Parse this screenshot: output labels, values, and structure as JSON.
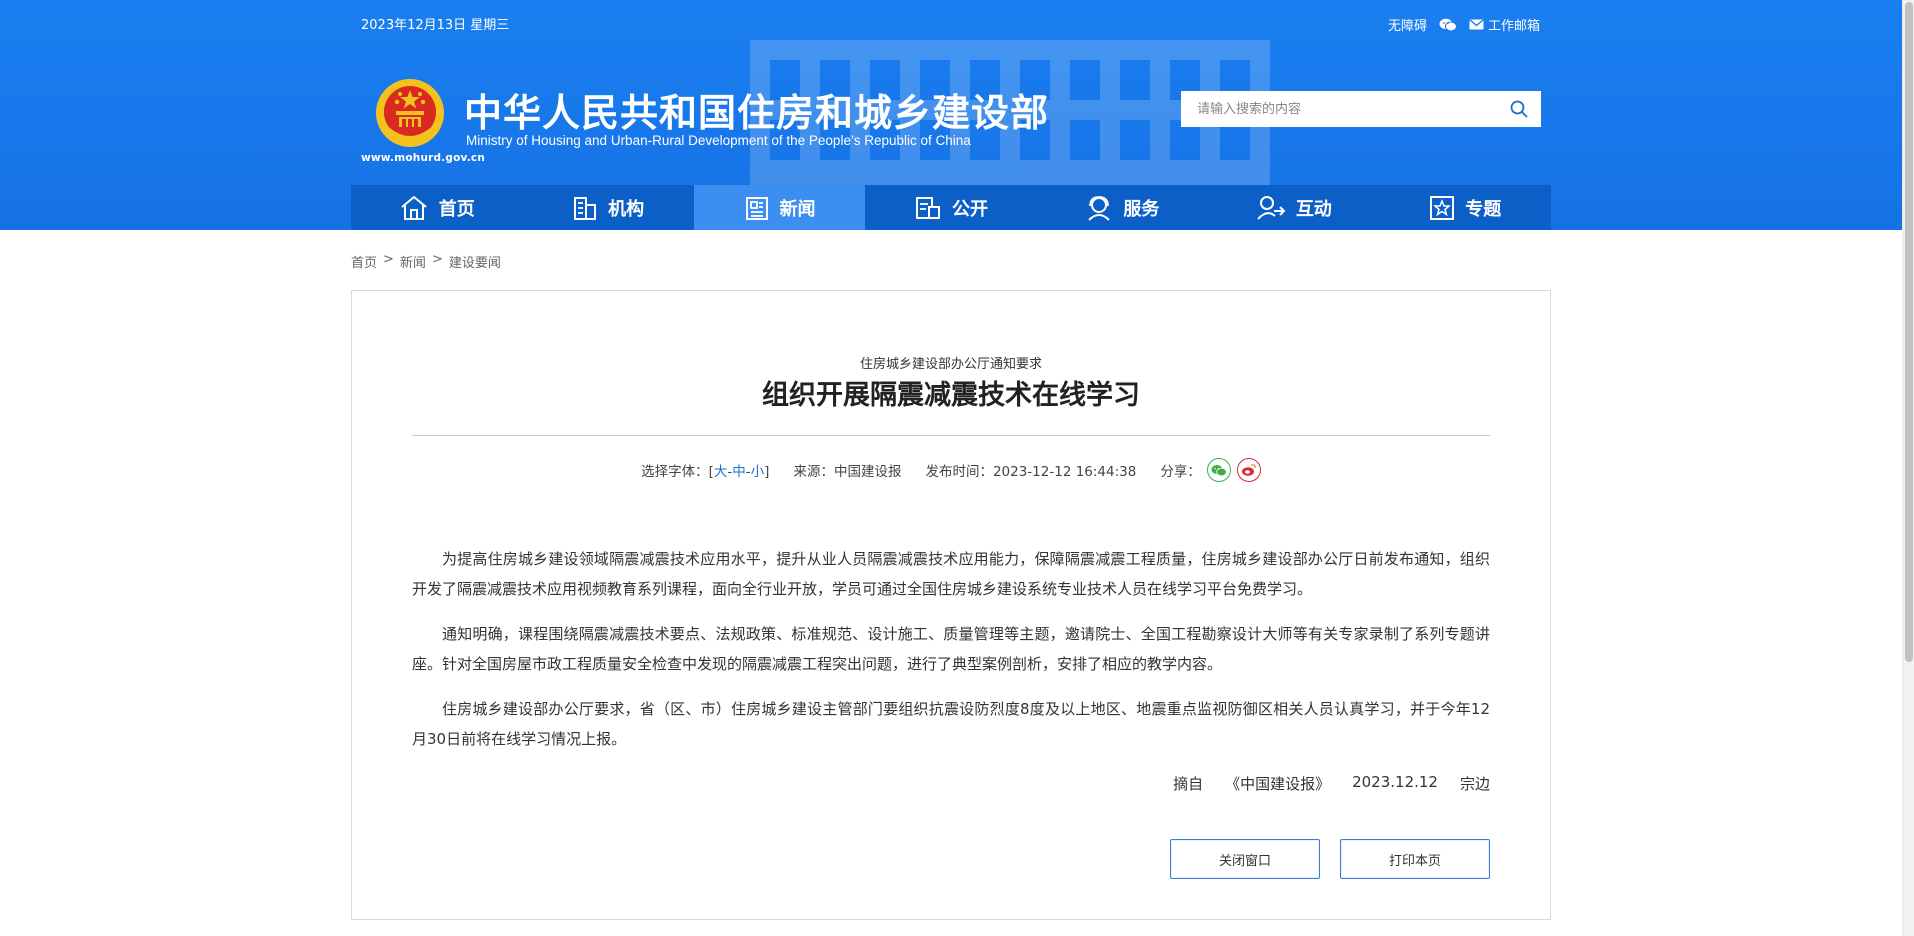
{
  "topbar": {
    "date": "2023年12月13日 星期三",
    "accessibility": "无障碍",
    "mail": "工作邮箱"
  },
  "branding": {
    "title": "中华人民共和国住房和城乡建设部",
    "subtitle": "Ministry of Housing and Urban-Rural Development of the People’s Republic of China",
    "url": "www.mohurd.gov.cn"
  },
  "search": {
    "placeholder": "请输入搜索的内容"
  },
  "nav": {
    "items": [
      {
        "label": "首页"
      },
      {
        "label": "机构"
      },
      {
        "label": "新闻"
      },
      {
        "label": "公开"
      },
      {
        "label": "服务"
      },
      {
        "label": "互动"
      },
      {
        "label": "专题"
      }
    ],
    "active_index": 2
  },
  "breadcrumb": {
    "home": "首页",
    "news": "新闻",
    "current": "建设要闻",
    "sep": ">"
  },
  "article": {
    "pretitle": "住房城乡建设部办公厅通知要求",
    "title": "组织开展隔震减震技术在线学习",
    "meta": {
      "font_label": "选择字体：[",
      "font_large": "大",
      "font_mid": "中",
      "font_small": "小",
      "font_dash": "-",
      "font_close": "]",
      "source": "来源：中国建设报",
      "published": "发布时间：2023-12-12 16:44:38",
      "share_label": "分享："
    },
    "paragraphs": [
      "为提高住房城乡建设领域隔震减震技术应用水平，提升从业人员隔震减震技术应用能力，保障隔震减震工程质量，住房城乡建设部办公厅日前发布通知，组织开发了隔震减震技术应用视频教育系列课程，面向全行业开放，学员可通过全国住房城乡建设系统专业技术人员在线学习平台免费学习。",
      "通知明确，课程围绕隔震减震技术要点、法规政策、标准规范、设计施工、质量管理等主题，邀请院士、全国工程勘察设计大师等有关专家录制了系列专题讲座。针对全国房屋市政工程质量安全检查中发现的隔震减震工程突出问题，进行了典型案例剖析，安排了相应的教学内容。",
      "住房城乡建设部办公厅要求，省（区、市）住房城乡建设主管部门要组织抗震设防烈度8度及以上地区、地震重点监视防御区相关人员认真学习，并于今年12月30日前将在线学习情况上报。"
    ],
    "source_line": {
      "excerpt": "摘自",
      "paper": "《中国建设报》",
      "date": "2023.12.12",
      "author": "宗边"
    },
    "buttons": {
      "close": "关闭窗口",
      "print": "打印本页"
    }
  },
  "colors": {
    "header_blue": "#1877ea",
    "nav_blue": "#0d5fc8",
    "nav_active": "#3c8ef0",
    "link_blue": "#1a6fd0",
    "wechat_green": "#3cae45",
    "weibo_red": "#d9283a"
  }
}
